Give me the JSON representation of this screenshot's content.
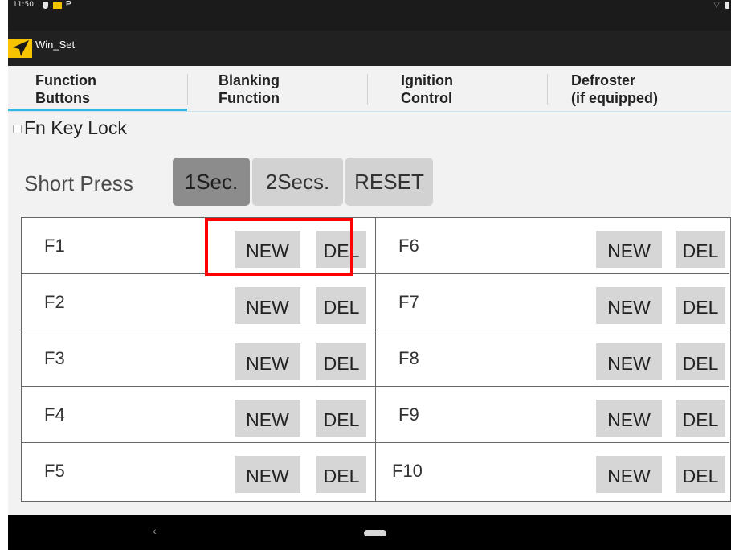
{
  "status_bar": {
    "time": "11:50",
    "icons": [
      "shield-icon",
      "mail-icon",
      "parking-icon",
      "wifi-icon",
      "battery-icon"
    ]
  },
  "app_bar": {
    "title": "Win_Set",
    "logo_icon": "navigation-arrow-icon"
  },
  "tabs": [
    {
      "label": "Function\nButtons",
      "selected": true
    },
    {
      "label": "Blanking\nFunction",
      "selected": false
    },
    {
      "label": "Ignition\nControl",
      "selected": false
    },
    {
      "label": "Defroster\n(if equipped)",
      "selected": false
    }
  ],
  "fn_key_lock": {
    "label": "Fn Key Lock",
    "checked": false
  },
  "short_press": {
    "label": "Short Press",
    "options": [
      "1Sec.",
      "2Secs.",
      "RESET"
    ],
    "selected": "1Sec."
  },
  "function_keys": {
    "left": [
      {
        "key": "F1",
        "new_label": "NEW",
        "del_label": "DEL"
      },
      {
        "key": "F2",
        "new_label": "NEW",
        "del_label": "DEL"
      },
      {
        "key": "F3",
        "new_label": "NEW",
        "del_label": "DEL"
      },
      {
        "key": "F4",
        "new_label": "NEW",
        "del_label": "DEL"
      },
      {
        "key": "F5",
        "new_label": "NEW",
        "del_label": "DEL"
      }
    ],
    "right": [
      {
        "key": "F6",
        "new_label": "NEW",
        "del_label": "DEL"
      },
      {
        "key": "F7",
        "new_label": "NEW",
        "del_label": "DEL"
      },
      {
        "key": "F8",
        "new_label": "NEW",
        "del_label": "DEL"
      },
      {
        "key": "F9",
        "new_label": "NEW",
        "del_label": "DEL"
      },
      {
        "key": "F10",
        "new_label": "NEW",
        "del_label": "DEL"
      }
    ]
  },
  "nav_bar": {
    "back_glyph": "‹",
    "icons": [
      "back-icon",
      "home-pill-icon"
    ]
  },
  "colors": {
    "tab_underline": "#33b5e5",
    "highlight": "#ff0000",
    "selected_segment": "#8c8c8c",
    "app_bar": "#212121",
    "logo": "#f7c400"
  }
}
